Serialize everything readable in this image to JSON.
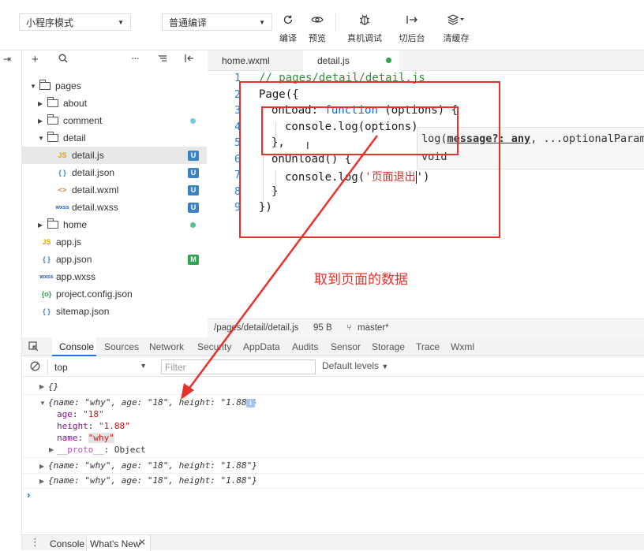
{
  "toolbar": {
    "mode_select": "小程序模式",
    "compile_select": "普通编译",
    "buttons": [
      {
        "label": "编译",
        "icon": "refresh-icon"
      },
      {
        "label": "预览",
        "icon": "eye-icon"
      },
      {
        "label": "真机调试",
        "icon": "bug-icon"
      },
      {
        "label": "切后台",
        "icon": "switch-icon"
      },
      {
        "label": "清缓存",
        "icon": "layers-icon"
      }
    ]
  },
  "sidebar": {
    "tree": [
      {
        "name": "pages",
        "kind": "folder",
        "expanded": true,
        "depth": 0
      },
      {
        "name": "about",
        "kind": "folder",
        "expanded": false,
        "depth": 1
      },
      {
        "name": "comment",
        "kind": "folder",
        "expanded": false,
        "depth": 1
      },
      {
        "name": "detail",
        "kind": "folder",
        "expanded": true,
        "depth": 1
      },
      {
        "name": "detail.js",
        "kind": "js",
        "depth": 2,
        "badge": "U",
        "selected": true
      },
      {
        "name": "detail.json",
        "kind": "json",
        "depth": 2,
        "badge": "U"
      },
      {
        "name": "detail.wxml",
        "kind": "wxml",
        "depth": 2,
        "badge": "U"
      },
      {
        "name": "detail.wxss",
        "kind": "wxss",
        "depth": 2,
        "badge": "U"
      },
      {
        "name": "home",
        "kind": "folder",
        "expanded": false,
        "depth": 1
      },
      {
        "name": "app.js",
        "kind": "js",
        "depth": 0
      },
      {
        "name": "app.json",
        "kind": "json",
        "depth": 0,
        "badge": "M"
      },
      {
        "name": "app.wxss",
        "kind": "wxss",
        "depth": 0
      },
      {
        "name": "project.config.json",
        "kind": "config",
        "depth": 0
      },
      {
        "name": "sitemap.json",
        "kind": "json",
        "depth": 0
      }
    ]
  },
  "editor": {
    "tabs": [
      "home.wxml",
      "detail.js"
    ],
    "lines": [
      "1",
      "2",
      "3",
      "4",
      "5",
      "6",
      "7",
      "8",
      "9"
    ],
    "code": {
      "l1": "// pages/detail/detail.js",
      "l2": "Page({",
      "l3a": "onLoad: ",
      "l3b": "function",
      "l3c": " (options) {",
      "l4": "console.log(options)",
      "l5": "},",
      "l6": "onUnload() {",
      "l7a": "console.log(",
      "l7b": "'页面退出",
      "l7c": "')",
      "l8": "}",
      "l9": "})"
    },
    "hint": {
      "sig_prefix": "log(",
      "sig_param": "message?: any",
      "sig_rest": ", ...optionalParam",
      "returns": "void"
    },
    "annotation": "取到页面的数据",
    "status": {
      "path": "/pages/detail/detail.js",
      "size": "95 B",
      "branch": "master*"
    }
  },
  "console": {
    "tabs": [
      "Console",
      "Sources",
      "Network",
      "Security",
      "AppData",
      "Audits",
      "Sensor",
      "Storage",
      "Trace",
      "Wxml"
    ],
    "context": "top",
    "filter_placeholder": "Filter",
    "levels": "Default levels",
    "logs": {
      "empty_obj": "{}",
      "obj_line": "{name: \"why\", age: \"18\", height: \"1.88\"}",
      "age_key": "age",
      "age_val": "\"18\"",
      "height_key": "height",
      "height_val": "\"1.88\"",
      "name_key": "name",
      "name_val": "\"why\"",
      "proto_key": "__proto__",
      "proto_val": "Object"
    },
    "bottom_tabs": [
      "Console",
      "What's New"
    ]
  },
  "colors": {
    "accent_blue": "#2b7fc9",
    "badge_green": "#2ea44f",
    "annotation_red": "#e5322d"
  }
}
